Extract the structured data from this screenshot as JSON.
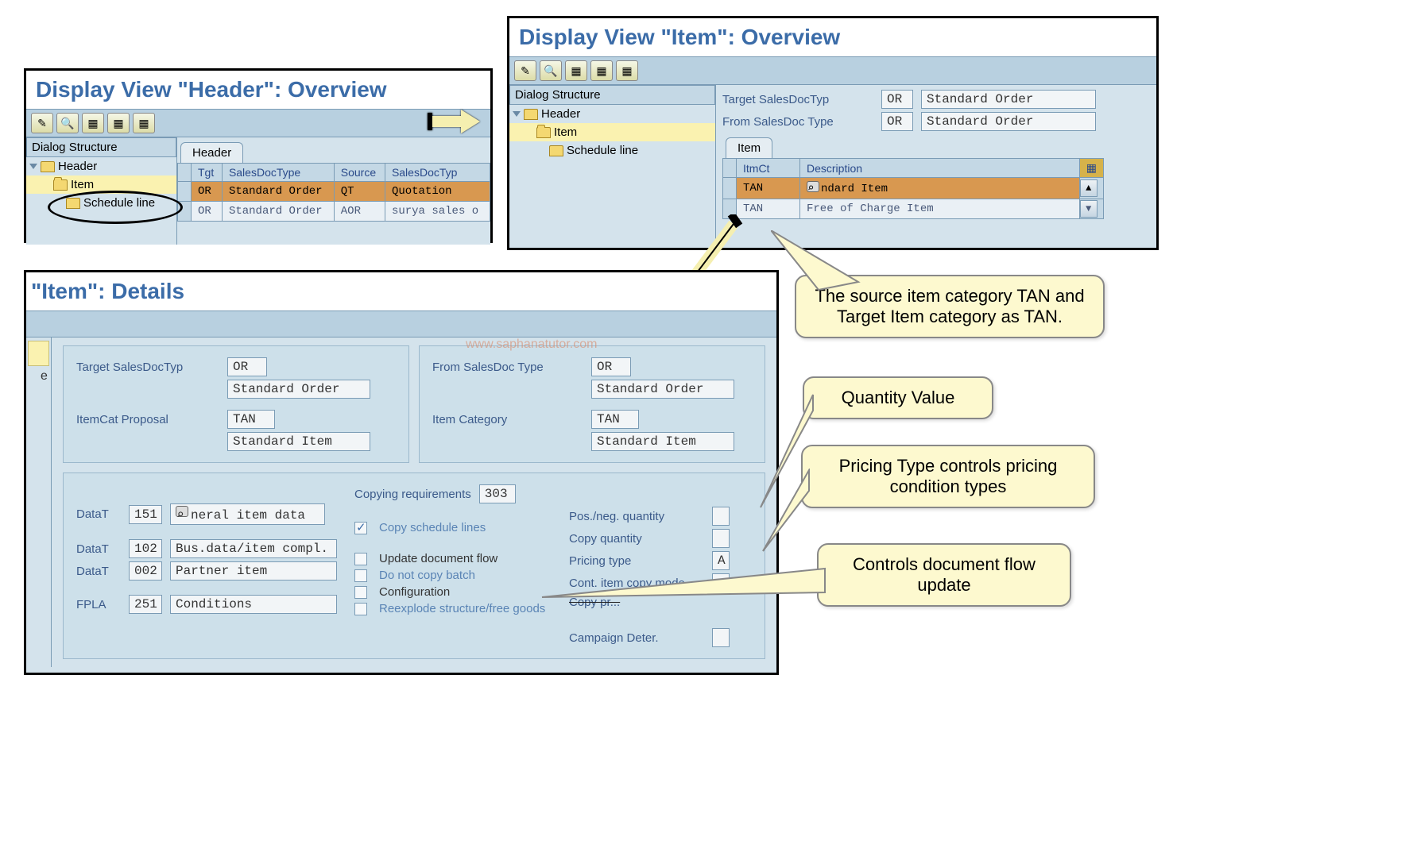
{
  "header_window": {
    "title": "Display View \"Header\": Overview",
    "tree_header": "Dialog Structure",
    "node_header": "Header",
    "node_item": "Item",
    "node_sched": "Schedule line",
    "tab": "Header",
    "cols": {
      "tgt": "Tgt",
      "sdt": "SalesDocType",
      "src": "Source",
      "sdt2": "SalesDocTyp"
    },
    "rows": [
      {
        "tgt": "OR",
        "sdt": "Standard Order",
        "src": "QT",
        "sdt2": "Quotation"
      },
      {
        "tgt": "OR",
        "sdt": "Standard Order",
        "src": "AOR",
        "sdt2": "surya sales o"
      }
    ]
  },
  "item_window": {
    "title": "Display View \"Item\": Overview",
    "tree_header": "Dialog Structure",
    "node_header": "Header",
    "node_item": "Item",
    "node_sched": "Schedule line",
    "target_label": "Target SalesDocTyp",
    "target_val": "OR",
    "target_desc": "Standard Order",
    "from_label": "From SalesDoc Type",
    "from_val": "OR",
    "from_desc": "Standard Order",
    "tab": "Item",
    "cols": {
      "itmct": "ItmCt",
      "desc": "Description"
    },
    "rows": [
      {
        "itmct": "TAN",
        "desc": "ndard Item"
      },
      {
        "itmct": "TAN",
        "desc": "Free of Charge Item"
      }
    ]
  },
  "details": {
    "title": "\"Item\": Details",
    "target_label": "Target SalesDocTyp",
    "target_val": "OR",
    "target_desc": "Standard Order",
    "from_label": "From SalesDoc Type",
    "from_val": "OR",
    "from_desc": "Standard Order",
    "itemcat_label": "ItemCat Proposal",
    "itemcat_val": "TAN",
    "itemcat_desc": "Standard Item",
    "itemcategory_label": "Item Category",
    "itemcategory_val": "TAN",
    "itemcategory_desc": "Standard Item",
    "datat_label": "DataT",
    "datat1_code": "151",
    "datat1_desc": "neral item data",
    "datat2_code": "102",
    "datat2_desc": "Bus.data/item compl.",
    "datat3_code": "002",
    "datat3_desc": "Partner item",
    "fpla_label": "FPLA",
    "fpla_code": "251",
    "fpla_desc": "Conditions",
    "copyreq_label": "Copying requirements",
    "copyreq_val": "303",
    "copy_sched": "Copy schedule lines",
    "update_flow": "Update document flow",
    "donot_copy": "Do not copy batch",
    "config": "Configuration",
    "reexplode": "Reexplode structure/free goods",
    "posneg": "Pos./neg. quantity",
    "copyqty": "Copy quantity",
    "pricing_type": "Pricing type",
    "pricing_type_val": "A",
    "contitem": "Cont. item copy mode",
    "copypr": "Copy pr...",
    "campaign": "Campaign Deter."
  },
  "callouts": {
    "c1": "The source item category TAN and Target Item category as TAN.",
    "c2": "Quantity Value",
    "c3": "Pricing Type controls pricing condition types",
    "c4": "Controls document flow update"
  },
  "watermark": "www.saphanatutor.com"
}
